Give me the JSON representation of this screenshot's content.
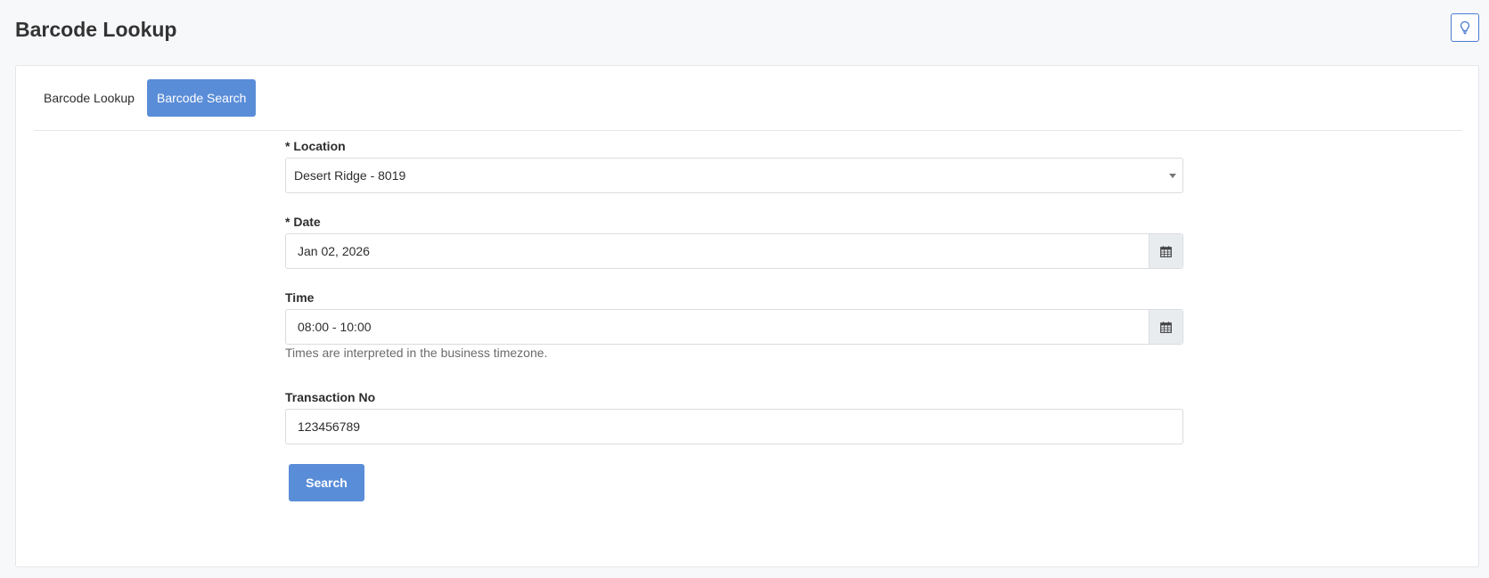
{
  "page": {
    "title": "Barcode Lookup"
  },
  "hint_icon": "lightbulb-icon",
  "tabs": [
    {
      "label": "Barcode Lookup",
      "active": false
    },
    {
      "label": "Barcode Search",
      "active": true
    }
  ],
  "form": {
    "location": {
      "label": "* Location",
      "value": "Desert Ridge - 8019"
    },
    "date": {
      "label": "* Date",
      "value": "Jan 02, 2026",
      "icon": "calendar-icon"
    },
    "time": {
      "label": "Time",
      "value": "08:00 - 10:00",
      "icon": "calendar-icon",
      "help": "Times are interpreted in the business timezone."
    },
    "transaction": {
      "label": "Transaction No",
      "value": "123456789"
    },
    "search_label": "Search"
  },
  "colors": {
    "accent": "#5a8dd8",
    "border": "#d9dce0"
  }
}
